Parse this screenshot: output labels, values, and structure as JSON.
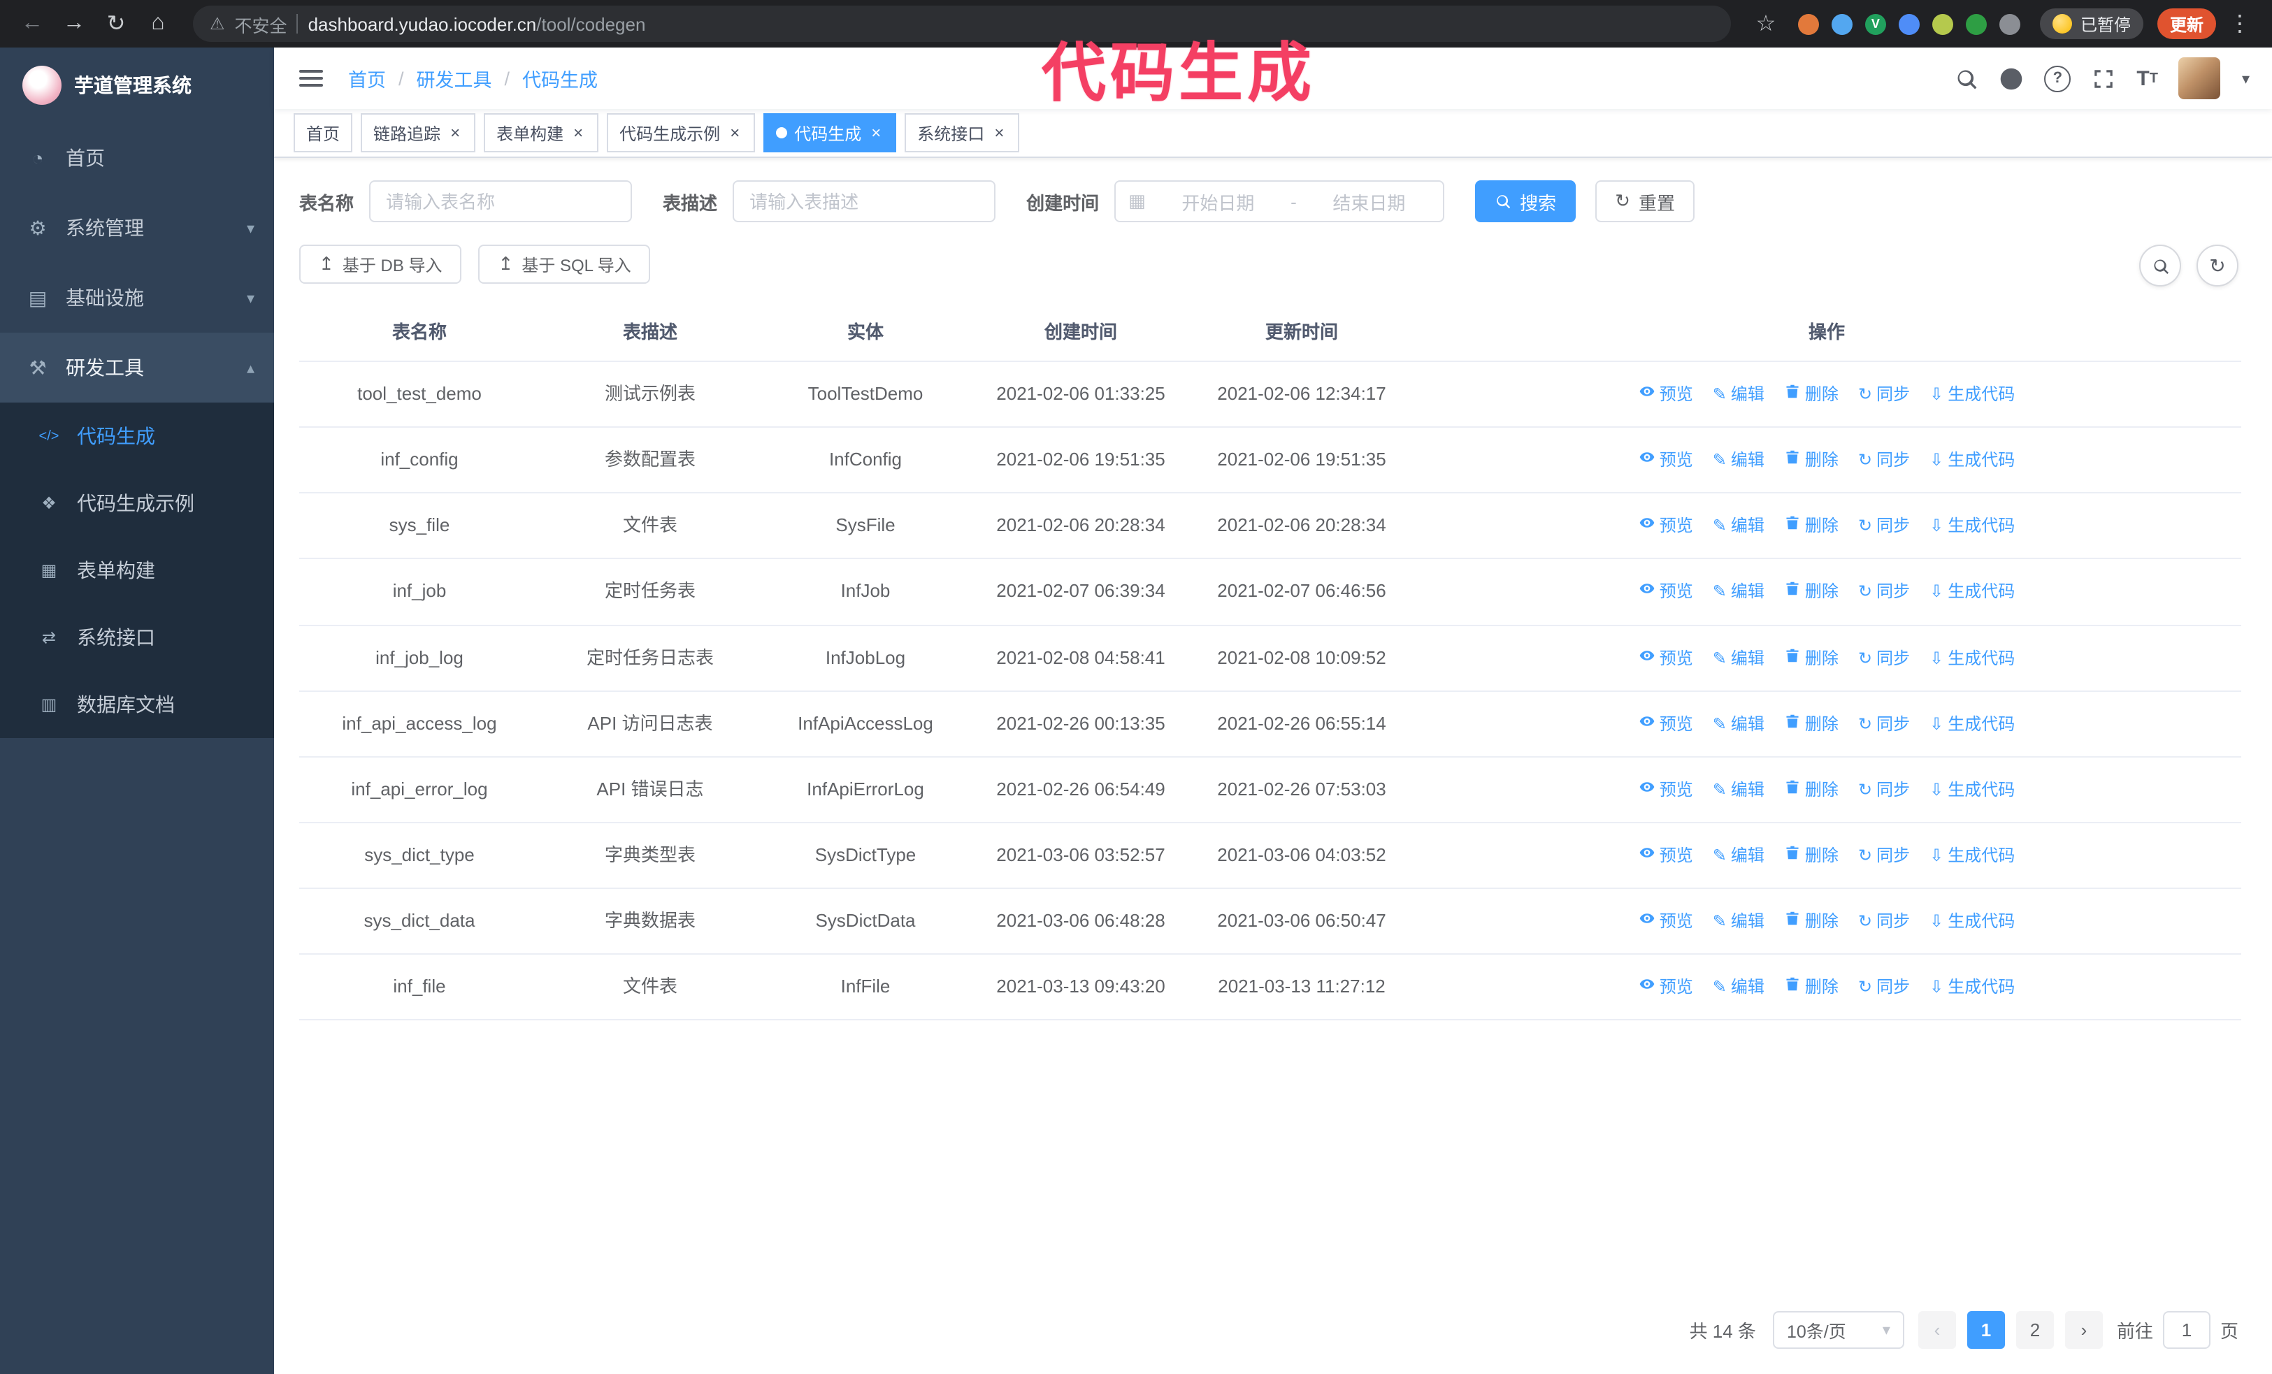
{
  "colors": {
    "accent": "#409eff",
    "annotation": "#f43f63",
    "sidebar-bg": "#304156",
    "submenu-bg": "#1f2d3d"
  },
  "annotation": {
    "text": "代码生成"
  },
  "browser": {
    "warning_label": "不安全",
    "url_host": "dashboard.yudao.iocoder.cn",
    "url_path": "/tool/codegen",
    "paused_badge_label": "已暂停",
    "update_button_label": "更新",
    "extensions": [
      {
        "color": "#e2793b"
      },
      {
        "color": "#53a7f0"
      },
      {
        "color": "#21a05d",
        "letter": "V"
      },
      {
        "color": "#4f8df7"
      },
      {
        "color": "#b5c94d"
      },
      {
        "color": "#2e9e44"
      },
      {
        "color": "#8b8e94"
      }
    ]
  },
  "sidebar": {
    "logo_text": "芋道管理系统",
    "menu": [
      {
        "id": "home",
        "label": "首页",
        "icon": "dashboard-icon",
        "type": "item"
      },
      {
        "id": "system",
        "label": "系统管理",
        "icon": "gear-icon",
        "type": "group",
        "state": "collapsed"
      },
      {
        "id": "infra",
        "label": "基础设施",
        "icon": "infra-icon",
        "type": "group",
        "state": "collapsed"
      },
      {
        "id": "devtools",
        "label": "研发工具",
        "icon": "tools-icon",
        "type": "group",
        "state": "expanded"
      },
      {
        "id": "codegen",
        "label": "代码生成",
        "icon": "code-icon",
        "type": "subitem",
        "active": true
      },
      {
        "id": "codegen-example",
        "label": "代码生成示例",
        "icon": "example-icon",
        "type": "subitem"
      },
      {
        "id": "form-builder",
        "label": "表单构建",
        "icon": "form-icon",
        "type": "subitem"
      },
      {
        "id": "api",
        "label": "系统接口",
        "icon": "api-icon",
        "type": "subitem"
      },
      {
        "id": "db-doc",
        "label": "数据库文档",
        "icon": "dbdoc-icon",
        "type": "subitem"
      }
    ]
  },
  "breadcrumb": {
    "separator": "/",
    "items": [
      "首页",
      "研发工具",
      "代码生成"
    ]
  },
  "tabs": [
    {
      "id": "home",
      "label": "首页",
      "closable": false,
      "active": false
    },
    {
      "id": "tracer",
      "label": "链路追踪",
      "closable": true,
      "active": false
    },
    {
      "id": "form-builder",
      "label": "表单构建",
      "closable": true,
      "active": false
    },
    {
      "id": "codegen-example",
      "label": "代码生成示例",
      "closable": true,
      "active": false
    },
    {
      "id": "codegen",
      "label": "代码生成",
      "closable": true,
      "active": true
    },
    {
      "id": "api",
      "label": "系统接口",
      "closable": true,
      "active": false
    }
  ],
  "filters": {
    "name_label": "表名称",
    "name_placeholder": "请输入表名称",
    "desc_label": "表描述",
    "desc_placeholder": "请输入表描述",
    "time_label": "创建时间",
    "start_placeholder": "开始日期",
    "range_separator": "-",
    "end_placeholder": "结束日期",
    "search_label": "搜索",
    "reset_label": "重置"
  },
  "toolbar": {
    "import_db_label": "基于 DB 导入",
    "import_sql_label": "基于 SQL 导入"
  },
  "table": {
    "columns": [
      "表名称",
      "表描述",
      "实体",
      "创建时间",
      "更新时间",
      "操作"
    ],
    "actions": [
      {
        "id": "preview",
        "label": "预览",
        "icon": "eye-icon"
      },
      {
        "id": "edit",
        "label": "编辑",
        "icon": "edit-icon"
      },
      {
        "id": "delete",
        "label": "删除",
        "icon": "trash-icon"
      },
      {
        "id": "sync",
        "label": "同步",
        "icon": "sync-icon"
      },
      {
        "id": "generate",
        "label": "生成代码",
        "icon": "download-icon"
      }
    ],
    "rows": [
      {
        "name": "tool_test_demo",
        "desc": "测试示例表",
        "entity": "ToolTestDemo",
        "created": "2021-02-06 01:33:25",
        "updated": "2021-02-06 12:34:17"
      },
      {
        "name": "inf_config",
        "desc": "参数配置表",
        "entity": "InfConfig",
        "created": "2021-02-06 19:51:35",
        "updated": "2021-02-06 19:51:35"
      },
      {
        "name": "sys_file",
        "desc": "文件表",
        "entity": "SysFile",
        "created": "2021-02-06 20:28:34",
        "updated": "2021-02-06 20:28:34"
      },
      {
        "name": "inf_job",
        "desc": "定时任务表",
        "entity": "InfJob",
        "created": "2021-02-07 06:39:34",
        "updated": "2021-02-07 06:46:56"
      },
      {
        "name": "inf_job_log",
        "desc": "定时任务日志表",
        "entity": "InfJobLog",
        "created": "2021-02-08 04:58:41",
        "updated": "2021-02-08 10:09:52"
      },
      {
        "name": "inf_api_access_log",
        "desc": "API 访问日志表",
        "entity": "InfApiAccessLog",
        "created": "2021-02-26 00:13:35",
        "updated": "2021-02-26 06:55:14"
      },
      {
        "name": "inf_api_error_log",
        "desc": "API 错误日志",
        "entity": "InfApiErrorLog",
        "created": "2021-02-26 06:54:49",
        "updated": "2021-02-26 07:53:03"
      },
      {
        "name": "sys_dict_type",
        "desc": "字典类型表",
        "entity": "SysDictType",
        "created": "2021-03-06 03:52:57",
        "updated": "2021-03-06 04:03:52"
      },
      {
        "name": "sys_dict_data",
        "desc": "字典数据表",
        "entity": "SysDictData",
        "created": "2021-03-06 06:48:28",
        "updated": "2021-03-06 06:50:47"
      },
      {
        "name": "inf_file",
        "desc": "文件表",
        "entity": "InfFile",
        "created": "2021-03-13 09:43:20",
        "updated": "2021-03-13 11:27:12"
      }
    ]
  },
  "pagination": {
    "total": "共 14 条",
    "page_size": "10条/页",
    "pages": [
      "1",
      "2"
    ],
    "current": "1",
    "goto_label": "前往",
    "goto_value": "1",
    "goto_suffix": "页"
  }
}
